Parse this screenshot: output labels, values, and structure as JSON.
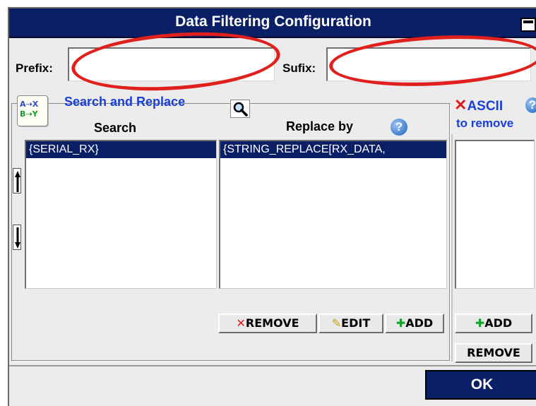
{
  "window": {
    "title": "Data Filtering Configuration"
  },
  "prefix": {
    "label": "Prefix:",
    "value": ""
  },
  "sufix": {
    "label": "Sufix:",
    "value": ""
  },
  "search_replace": {
    "title": "Search and Replace",
    "search_header": "Search",
    "replace_header": "Replace by",
    "search_items": [
      "{SERIAL_RX}"
    ],
    "replace_items": [
      "{STRING_REPLACE[RX_DATA,"
    ],
    "remove_label": "REMOVE",
    "edit_label": "EDIT",
    "add_label": "ADD"
  },
  "ascii": {
    "title": "ASCII",
    "subtitle": "to remove",
    "add_label": "ADD",
    "remove_label": "REMOVE"
  },
  "footer": {
    "ok_label": "OK"
  },
  "colors": {
    "titlebar": "#0b1f66",
    "link_blue": "#1a3fd6",
    "annotation_red": "#e0201c"
  },
  "icons": [
    "restore-icon",
    "search-replace-icon",
    "magnifier-icon",
    "help-icon",
    "move-up-icon",
    "move-down-icon",
    "x-icon",
    "pencil-icon",
    "plus-icon"
  ]
}
